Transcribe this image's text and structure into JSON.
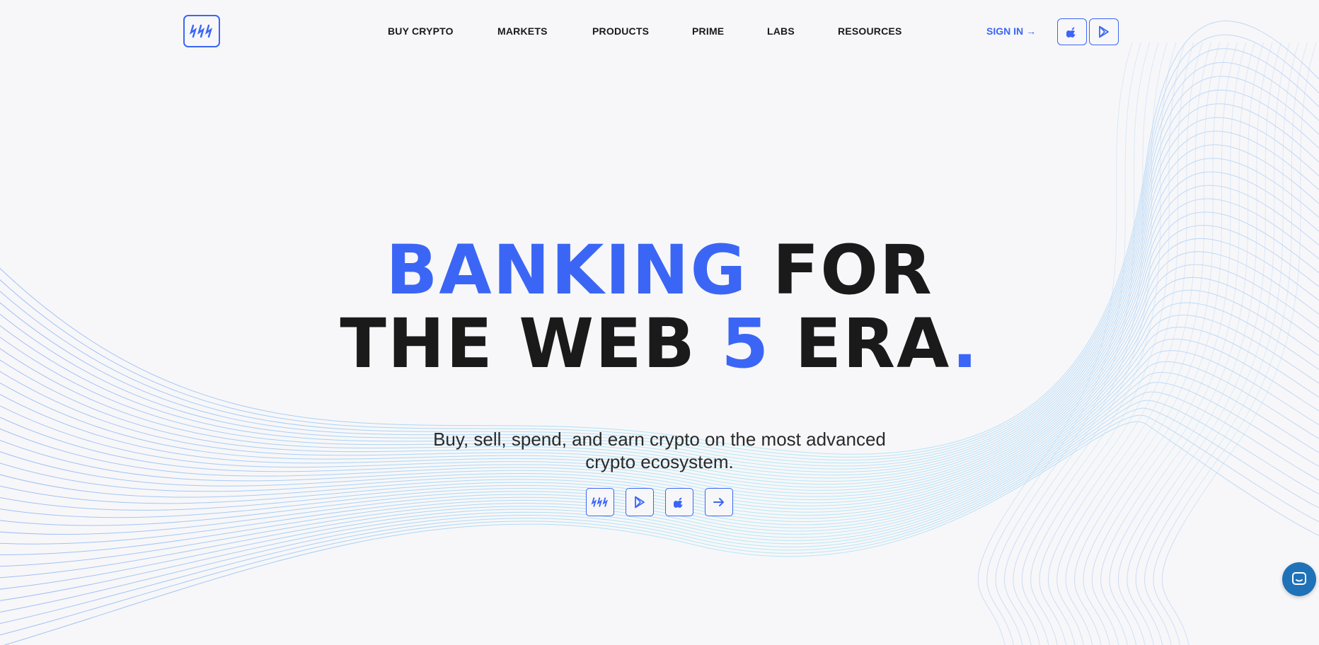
{
  "nav": {
    "items": [
      {
        "label": "BUY CRYPTO"
      },
      {
        "label": "MARKETS"
      },
      {
        "label": "PRODUCTS"
      },
      {
        "label": "PRIME"
      },
      {
        "label": "LABS"
      },
      {
        "label": "RESOURCES"
      }
    ],
    "signin_label": "SIGN IN",
    "signin_arrow": "→"
  },
  "icons": {
    "logo": "brand-logo-icon",
    "header_store_1": "apple-icon",
    "header_store_2": "google-play-icon",
    "cta_1": "brand-logo-icon",
    "cta_2": "google-play-icon",
    "cta_3": "apple-icon",
    "cta_4": "arrow-right-icon",
    "chat": "chat-icon"
  },
  "hero": {
    "line1_blue": "BANKING",
    "line1_rest": " FOR",
    "line2_start": "THE WEB ",
    "line2_blue": "5",
    "line2_mid": " ERA",
    "line2_dot": ".",
    "subtitle_line1": "Buy, sell, spend, and earn crypto on the most advanced",
    "subtitle_line2": "crypto ecosystem."
  },
  "colors": {
    "accent": "#3b66f5",
    "text": "#1a1a1a",
    "background": "#f7f7f9",
    "chat": "#1f72b8"
  }
}
